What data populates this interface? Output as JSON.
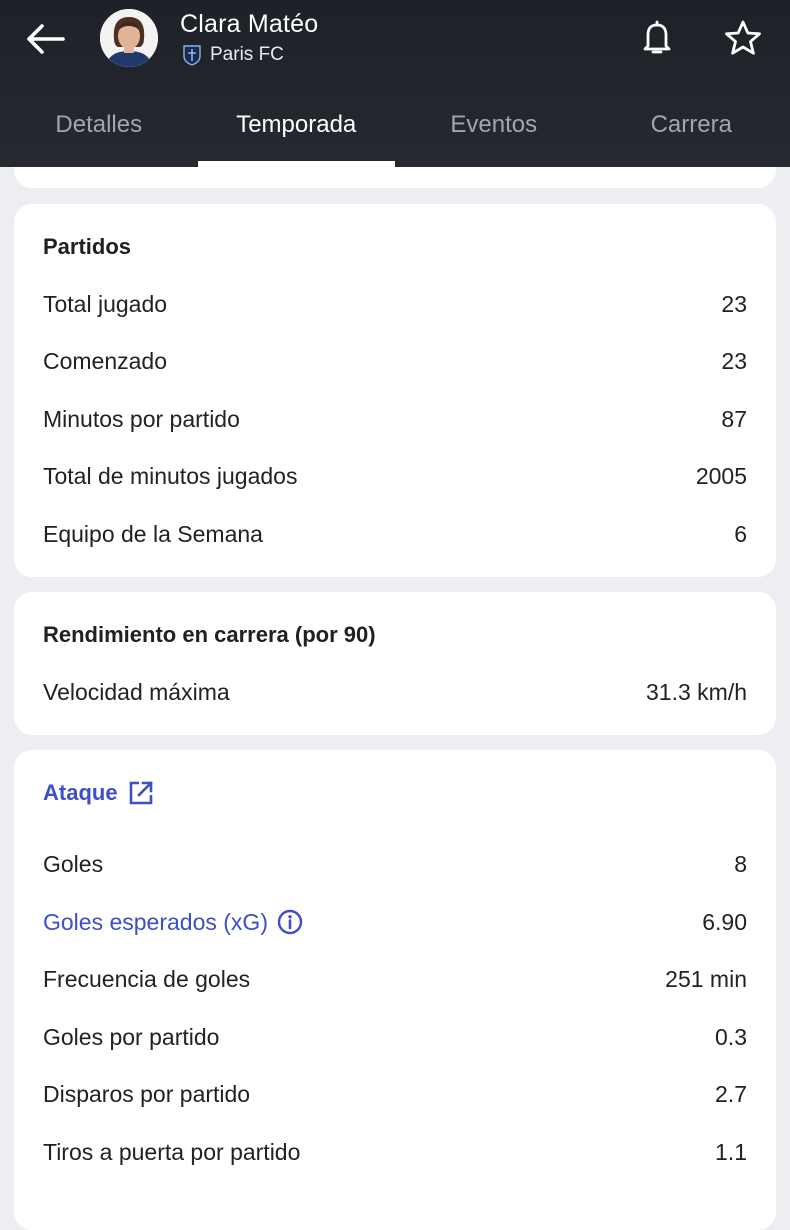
{
  "header": {
    "player_name": "Clara Matéo",
    "team_name": "Paris FC",
    "icons": {
      "back": "arrow-left-icon",
      "notify": "bell-icon",
      "favorite": "star-icon",
      "team_badge": "paris-fc-crest-icon"
    }
  },
  "tabs": [
    {
      "label": "Detalles",
      "active": false
    },
    {
      "label": "Temporada",
      "active": true
    },
    {
      "label": "Eventos",
      "active": false
    },
    {
      "label": "Carrera",
      "active": false
    }
  ],
  "partidos": {
    "title": "Partidos",
    "rows": [
      {
        "label": "Total jugado",
        "value": "23"
      },
      {
        "label": "Comenzado",
        "value": "23"
      },
      {
        "label": "Minutos por partido",
        "value": "87"
      },
      {
        "label": "Total de minutos jugados",
        "value": "2005"
      },
      {
        "label": "Equipo de la Semana",
        "value": "6"
      }
    ]
  },
  "rendimiento": {
    "title": "Rendimiento en carrera (por 90)",
    "rows": [
      {
        "label": "Velocidad máxima",
        "value": "31.3 km/h"
      }
    ]
  },
  "ataque": {
    "title": "Ataque",
    "rows": [
      {
        "label": "Goles",
        "value": "8"
      },
      {
        "label": "Goles esperados (xG)",
        "value": "6.90"
      },
      {
        "label": "Frecuencia de goles",
        "value": "251 min"
      },
      {
        "label": "Goles por partido",
        "value": "0.3"
      },
      {
        "label": "Disparos por partido",
        "value": "2.7"
      },
      {
        "label": "Tiros a puerta por partido",
        "value": "1.1"
      }
    ]
  },
  "colors": {
    "header_bg": "#23262d",
    "accent_link": "#3e4fc9",
    "page_bg": "#edeef2"
  }
}
